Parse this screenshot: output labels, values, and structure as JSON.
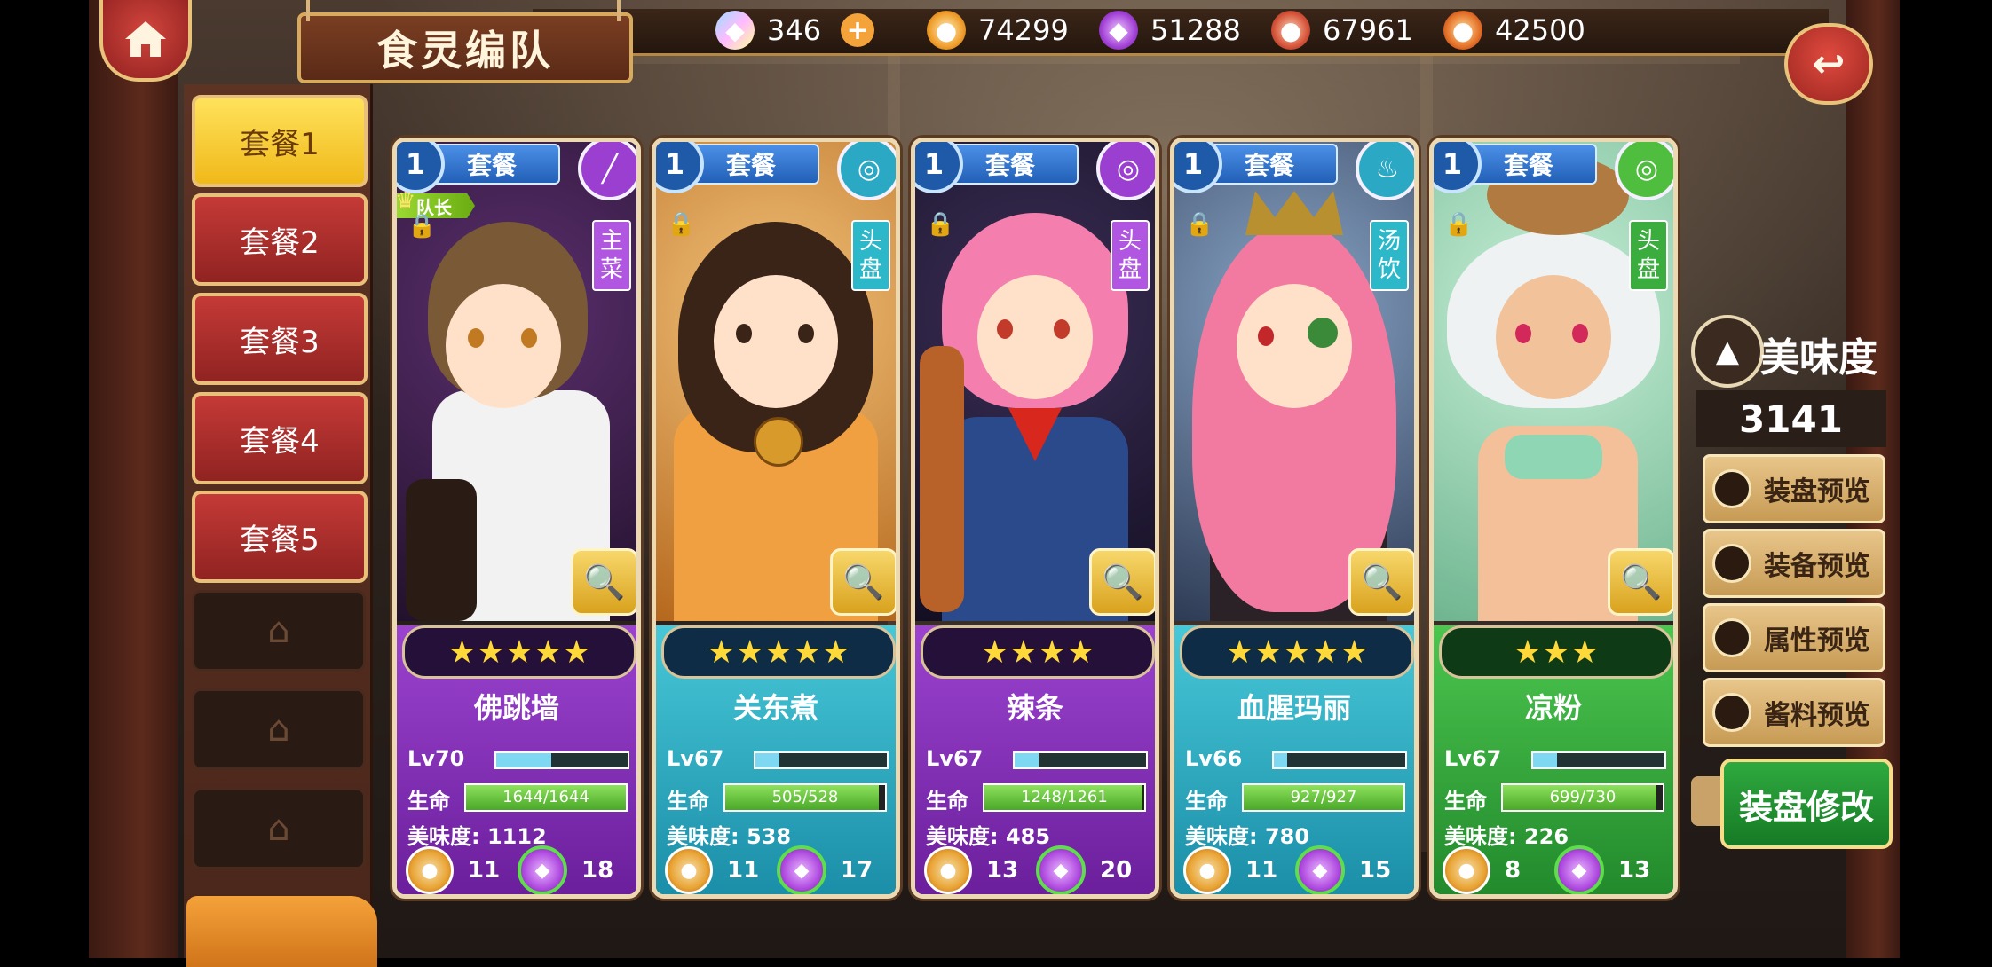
{
  "header": {
    "title": "食灵编队",
    "resources": [
      {
        "icon": "rainbow-crystal-icon",
        "value": "346",
        "has_add": true
      },
      {
        "icon": "oil-flask-icon",
        "value": "74299"
      },
      {
        "icon": "purple-gem-icon",
        "value": "51288"
      },
      {
        "icon": "meat-icon",
        "value": "67961"
      },
      {
        "icon": "gold-pot-icon",
        "value": "42500"
      }
    ]
  },
  "sets": [
    {
      "label": "套餐1",
      "active": true
    },
    {
      "label": "套餐2"
    },
    {
      "label": "套餐3"
    },
    {
      "label": "套餐4"
    },
    {
      "label": "套餐5"
    }
  ],
  "cards": [
    {
      "num": "1",
      "set": "套餐",
      "type_tag": "主菜",
      "leader": "队长",
      "stars": "★★★★★",
      "name": "佛跳墙",
      "lv": "Lv70",
      "lv_frac": 0.42,
      "hp_label": "生命",
      "hp": "1644/1644",
      "hp_frac": 1.0,
      "taste": "美味度: 1112",
      "oil": "11",
      "gem": "18",
      "color": "purple"
    },
    {
      "num": "1",
      "set": "套餐",
      "type_tag": "头盘",
      "stars": "★★★★★",
      "name": "关东煮",
      "lv": "Lv67",
      "lv_frac": 0.18,
      "hp_label": "生命",
      "hp": "505/528",
      "hp_frac": 0.96,
      "taste": "美味度: 538",
      "oil": "11",
      "gem": "17",
      "color": "teal"
    },
    {
      "num": "1",
      "set": "套餐",
      "type_tag": "头盘",
      "stars": "★★★★",
      "name": "辣条",
      "lv": "Lv67",
      "lv_frac": 0.18,
      "hp_label": "生命",
      "hp": "1248/1261",
      "hp_frac": 0.99,
      "taste": "美味度: 485",
      "oil": "13",
      "gem": "20",
      "color": "purple"
    },
    {
      "num": "1",
      "set": "套餐",
      "type_tag": "汤饮",
      "stars": "★★★★★",
      "name": "血腥玛丽",
      "lv": "Lv66",
      "lv_frac": 0.1,
      "hp_label": "生命",
      "hp": "927/927",
      "hp_frac": 1.0,
      "taste": "美味度: 780",
      "oil": "11",
      "gem": "15",
      "color": "teal"
    },
    {
      "num": "1",
      "set": "套餐",
      "type_tag": "头盘",
      "stars": "★★★",
      "name": "凉粉",
      "lv": "Lv67",
      "lv_frac": 0.18,
      "hp_label": "生命",
      "hp": "699/730",
      "hp_frac": 0.96,
      "taste": "美味度: 226",
      "oil": "8",
      "gem": "13",
      "color": "green"
    }
  ],
  "taste": {
    "title": "美味度",
    "value": "3141"
  },
  "previews": [
    "装盘预览",
    "装备预览",
    "属性预览",
    "酱料预览"
  ],
  "modify_label": "装盘修改"
}
